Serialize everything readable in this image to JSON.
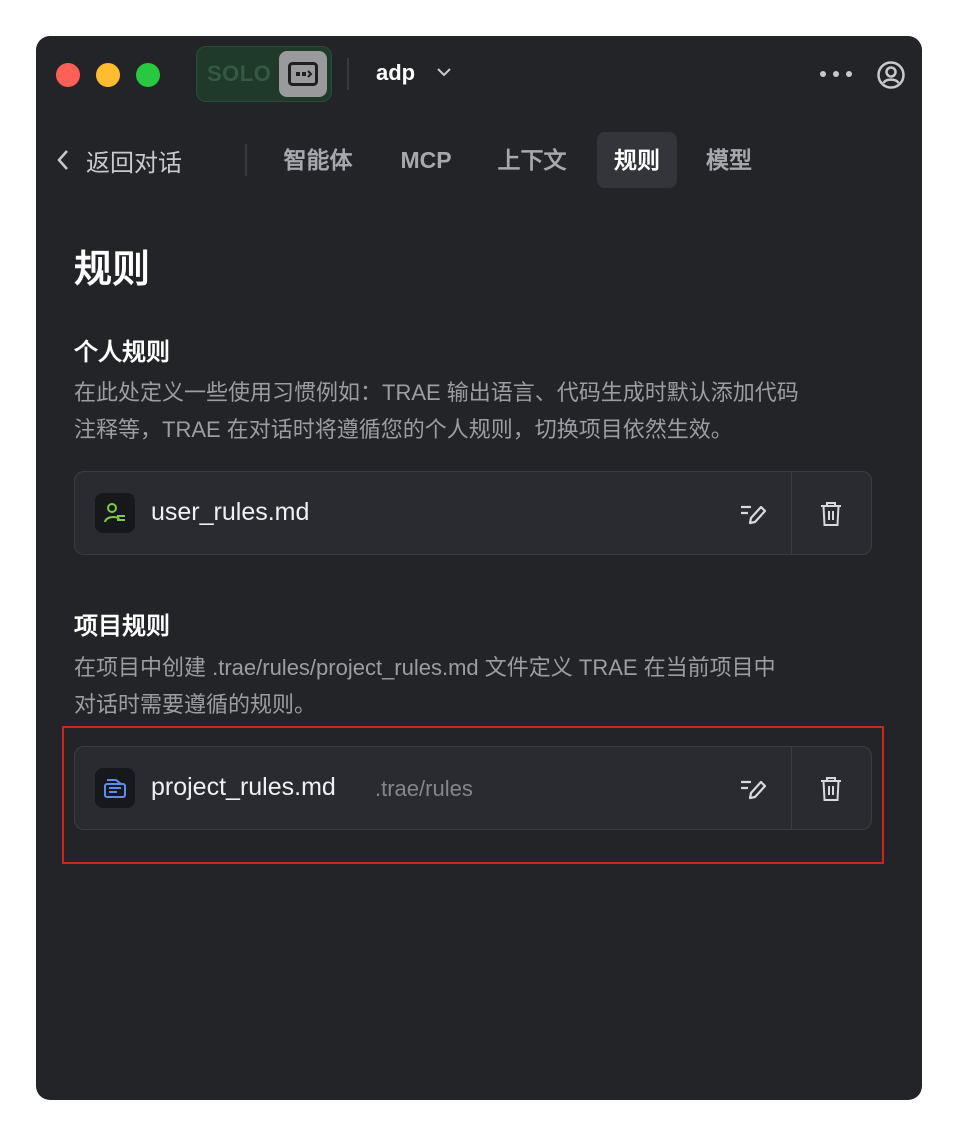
{
  "titlebar": {
    "solo_label": "SOLO",
    "project_name": "adp"
  },
  "nav": {
    "back_label": "返回对话",
    "tabs": [
      {
        "label": "智能体"
      },
      {
        "label": "MCP"
      },
      {
        "label": "上下文"
      },
      {
        "label": "规则"
      },
      {
        "label": "模型"
      }
    ],
    "active_tab": "规则"
  },
  "page": {
    "title": "规则",
    "personal": {
      "title": "个人规则",
      "desc_line1": "在此处定义一些使用习惯例如：TRAE 输出语言、代码生成时默认添加代码",
      "desc_line2": "注释等，TRAE 在对话时将遵循您的个人规则，切换项目依然生效。",
      "file": {
        "name": "user_rules.md",
        "icon": "user-rules-icon",
        "icon_color": "#7fc74a"
      }
    },
    "project": {
      "title": "项目规则",
      "desc_line1": "在项目中创建 .trae/rules/project_rules.md 文件定义 TRAE 在当前项目中",
      "desc_line2": "对话时需要遵循的规则。",
      "file": {
        "name": "project_rules.md",
        "path": ".trae/rules",
        "icon": "project-rules-icon",
        "icon_color": "#5b8def"
      }
    }
  },
  "colors": {
    "background": "#232428",
    "highlight": "#d0231f",
    "traffic_red": "#fe5f57",
    "traffic_yellow": "#febc2e",
    "traffic_green": "#28c840"
  }
}
